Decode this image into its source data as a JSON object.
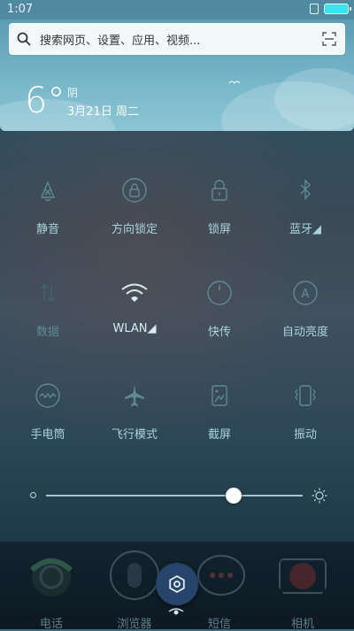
{
  "status_bar": {
    "time": "1:07"
  },
  "search": {
    "placeholder": "搜索网页、设置、应用、视频..."
  },
  "weather": {
    "temperature": "6°",
    "condition": "阴",
    "date": "3月21日 周二"
  },
  "toggles": [
    {
      "label": "静音",
      "icon": "silent-bell-icon",
      "state": "off"
    },
    {
      "label": "方向锁定",
      "icon": "rotation-lock-icon",
      "state": "off"
    },
    {
      "label": "锁屏",
      "icon": "lock-icon",
      "state": "off"
    },
    {
      "label": "蓝牙◢",
      "icon": "bluetooth-icon",
      "state": "off"
    },
    {
      "label": "数据",
      "icon": "mobile-data-icon",
      "state": "disabled"
    },
    {
      "label": "WLAN◢",
      "icon": "wifi-icon",
      "state": "on"
    },
    {
      "label": "快传",
      "icon": "quick-transfer-icon",
      "state": "off"
    },
    {
      "label": "自动亮度",
      "icon": "auto-brightness-icon",
      "state": "off"
    },
    {
      "label": "手电筒",
      "icon": "flashlight-icon",
      "state": "off"
    },
    {
      "label": "飞行模式",
      "icon": "airplane-icon",
      "state": "off"
    },
    {
      "label": "截屏",
      "icon": "screenshot-icon",
      "state": "off"
    },
    {
      "label": "振动",
      "icon": "vibrate-icon",
      "state": "off"
    }
  ],
  "brightness": {
    "level": 0.73
  },
  "dock": [
    {
      "label": "电话",
      "icon": "phone-icon"
    },
    {
      "label": "浏览器",
      "icon": "browser-icon"
    },
    {
      "label": "短信",
      "icon": "message-icon"
    },
    {
      "label": "相机",
      "icon": "camera-icon"
    }
  ],
  "colors": {
    "accent": "#37e5f2",
    "header": "#5b9db3",
    "label": "#a9d3dc"
  }
}
